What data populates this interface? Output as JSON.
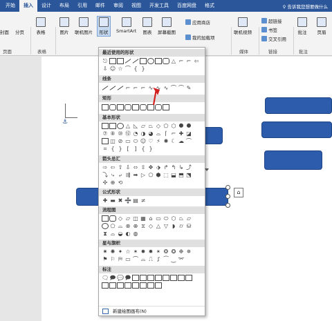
{
  "tabs": [
    "开始",
    "插入",
    "设计",
    "布局",
    "引用",
    "邮件",
    "审阅",
    "视图",
    "开发工具",
    "百度网盘",
    "格式"
  ],
  "active_tab": "插入",
  "tell_me": "告诉我您想要做什么",
  "ribbon": {
    "cover_page": "封面",
    "page_break": "分页",
    "pages_group": "页面",
    "table": "表格",
    "table_group": "表格",
    "picture": "图片",
    "online_picture": "联机图片",
    "shapes": "形状",
    "smartart": "SmartArt",
    "chart": "图表",
    "screenshot": "屏幕截图",
    "app_store": "应用商店",
    "my_addins": "我的加载项",
    "online_video": "联机视频",
    "media_group": "媒体",
    "hyperlink": "超链接",
    "bookmark": "书签",
    "cross_ref": "交叉引用",
    "links_group": "链接",
    "comment": "批注",
    "comment_group": "批注",
    "header": "页眉"
  },
  "menu": {
    "sections": [
      "最近使用的形状",
      "线条",
      "矩形",
      "基本形状",
      "箭头总汇",
      "公式形状",
      "流程图",
      "星与旗帜",
      "标注"
    ],
    "new_canvas": "新建绘图画布(N)"
  },
  "colors": {
    "accent": "#2b579a",
    "shape_fill": "#2c5cab",
    "arrow": "#d22020"
  }
}
